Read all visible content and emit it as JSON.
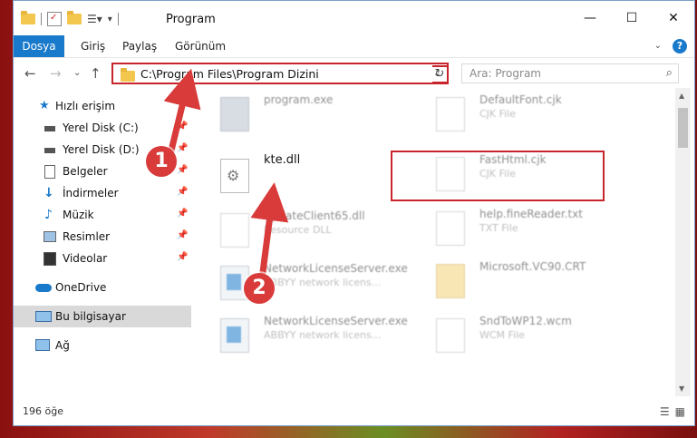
{
  "window": {
    "title": "Program"
  },
  "ribbon": {
    "tabs": [
      "Dosya",
      "Giriş",
      "Paylaş",
      "Görünüm"
    ]
  },
  "address": {
    "path": "C:\\Program Files\\Program Dizini"
  },
  "search": {
    "placeholder": "Ara: Program"
  },
  "nav": {
    "items": [
      {
        "label": "Hızlı erişim",
        "icon": "star-icon",
        "pinned": false
      },
      {
        "label": "Yerel Disk (C:)",
        "icon": "drive-icon",
        "pinned": true
      },
      {
        "label": "Yerel Disk (D:)",
        "icon": "drive-icon",
        "pinned": true
      },
      {
        "label": "Belgeler",
        "icon": "documents-icon",
        "pinned": true
      },
      {
        "label": "İndirmeler",
        "icon": "download-icon",
        "pinned": true
      },
      {
        "label": "Müzik",
        "icon": "music-icon",
        "pinned": true
      },
      {
        "label": "Resimler",
        "icon": "pictures-icon",
        "pinned": true
      },
      {
        "label": "Videolar",
        "icon": "video-icon",
        "pinned": true
      },
      {
        "label": "OneDrive",
        "icon": "cloud-icon",
        "pinned": false
      },
      {
        "label": "Bu bilgisayar",
        "icon": "computer-icon",
        "pinned": false,
        "selected": true
      },
      {
        "label": "Ağ",
        "icon": "network-icon",
        "pinned": false
      }
    ]
  },
  "files": {
    "left": [
      {
        "name": "program.exe",
        "type": ""
      },
      {
        "name": "kte.dll",
        "type": ""
      },
      {
        "name": "UpdateClient65.dll",
        "type": "Resource DLL"
      },
      {
        "name": "NetworkLicenseServer.exe",
        "type": "ABBYY network licens..."
      },
      {
        "name": "NetworkLicenseServer.exe",
        "type": "ABBYY network licens..."
      }
    ],
    "right": [
      {
        "name": "DefaultFont.cjk",
        "type": "CJK File"
      },
      {
        "name": "FastHtml.cjk",
        "type": "CJK File"
      },
      {
        "name": "help.fineReader.txt",
        "type": "TXT File"
      },
      {
        "name": "Microsoft.VC90.CRT",
        "type": ""
      },
      {
        "name": "SndToWP12.wcm",
        "type": "WCM File"
      }
    ]
  },
  "status": {
    "count": "196 öğe"
  },
  "annotations": {
    "step1": "1",
    "step2": "2"
  },
  "colors": {
    "accent": "#1979ca",
    "highlight": "#c8242b",
    "badge": "#d93a3a"
  }
}
